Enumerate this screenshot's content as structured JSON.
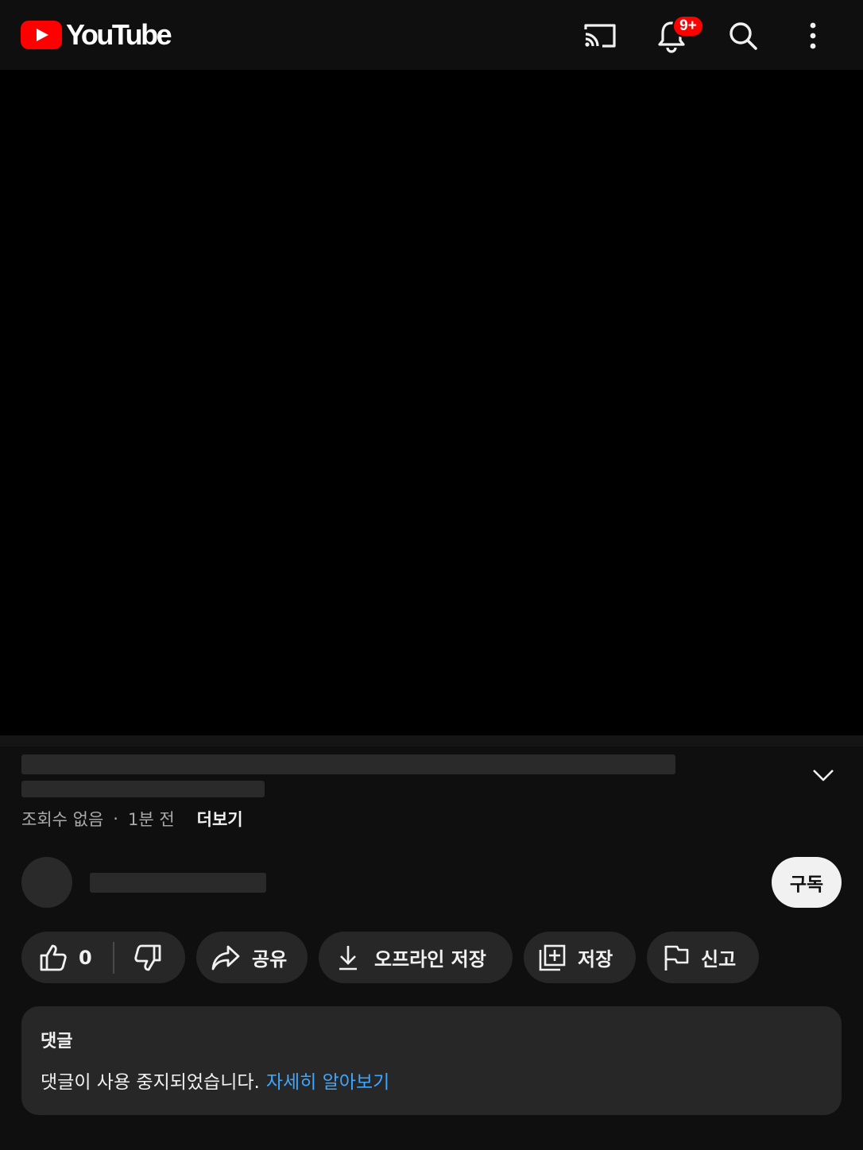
{
  "header": {
    "logo_text": "YouTube",
    "notification_badge": "9+",
    "icons": [
      "cast-icon",
      "bell-icon",
      "search-icon",
      "more-vert-icon"
    ]
  },
  "video": {
    "views": "조회수 없음",
    "separator": "·",
    "age": "1분 전",
    "more_label": "더보기"
  },
  "channel": {
    "subscribe_label": "구독"
  },
  "actions": {
    "like_count": "0",
    "share_label": "공유",
    "download_label": "오프라인 저장",
    "save_label": "저장",
    "report_label": "신고"
  },
  "comments": {
    "title": "댓글",
    "disabled_message": "댓글이 사용 중지되었습니다.",
    "learn_more": "자세히 알아보기"
  },
  "colors": {
    "background": "#0f0f0f",
    "player": "#000000",
    "pill": "#272727",
    "brand_red": "#ff0000",
    "link_blue": "#3ea6ff"
  }
}
